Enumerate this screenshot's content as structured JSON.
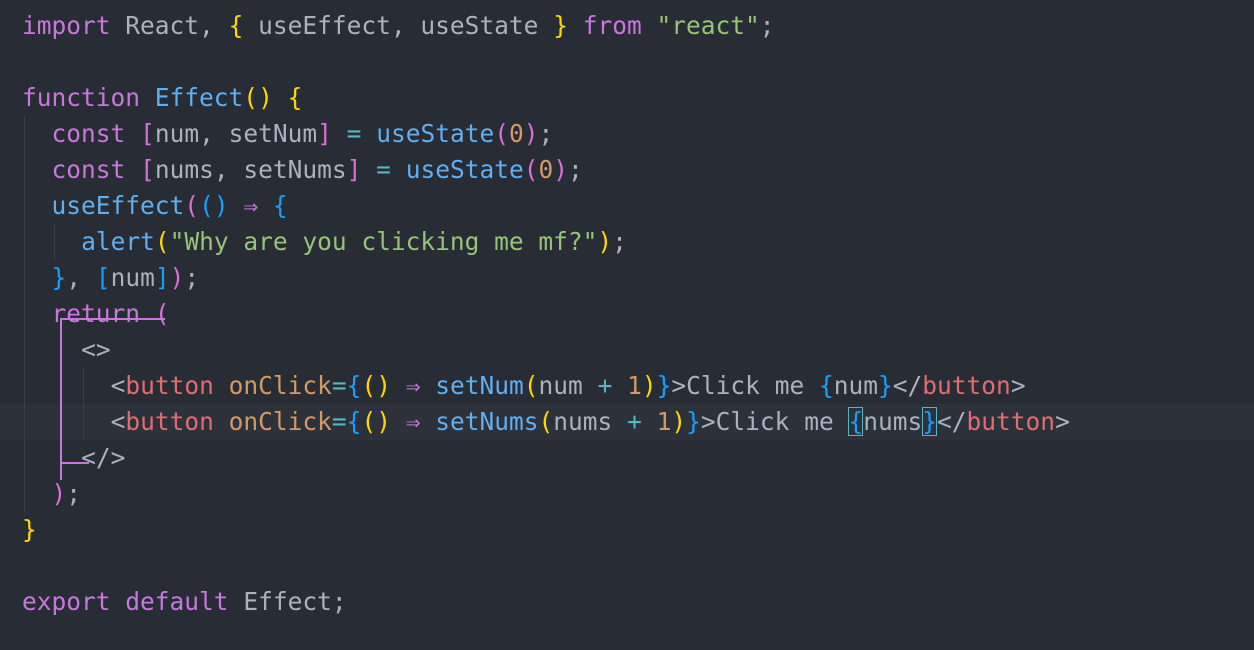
{
  "editor": {
    "language": "javascript-react",
    "theme_colors": {
      "background": "#282c34",
      "current_line": "#2c313a",
      "keyword": "#c678dd",
      "function": "#61afef",
      "string": "#98c379",
      "number": "#d19a66",
      "tag": "#e06c75",
      "attribute": "#d19a66",
      "bracket_gold": "#ffd700",
      "bracket_pink": "#da70d6",
      "bracket_blue": "#179fff",
      "text": "#abb2bf"
    },
    "lines": [
      {
        "id": 1,
        "text": "import React, { useEffect, useState } from \"react\";"
      },
      {
        "id": 2,
        "text": ""
      },
      {
        "id": 3,
        "text": "function Effect() {"
      },
      {
        "id": 4,
        "text": "  const [num, setNum] = useState(0);"
      },
      {
        "id": 5,
        "text": "  const [nums, setNums] = useState(0);"
      },
      {
        "id": 6,
        "text": "  useEffect(() ⇒ {"
      },
      {
        "id": 7,
        "text": "    alert(\"Why are you clicking me mf?\");"
      },
      {
        "id": 8,
        "text": "  }, [num]);"
      },
      {
        "id": 9,
        "text": "  return ("
      },
      {
        "id": 10,
        "text": "    <>"
      },
      {
        "id": 11,
        "text": "      <button onClick={() ⇒ setNum(num + 1)}>Click me {num}</button>"
      },
      {
        "id": 12,
        "text": "      <button onClick={() ⇒ setNums(nums + 1)}>Click me {nums}</button>"
      },
      {
        "id": 13,
        "text": "    </>"
      },
      {
        "id": 14,
        "text": "  );"
      },
      {
        "id": 15,
        "text": "}"
      },
      {
        "id": 16,
        "text": ""
      },
      {
        "id": 17,
        "text": "export default Effect;"
      }
    ]
  }
}
